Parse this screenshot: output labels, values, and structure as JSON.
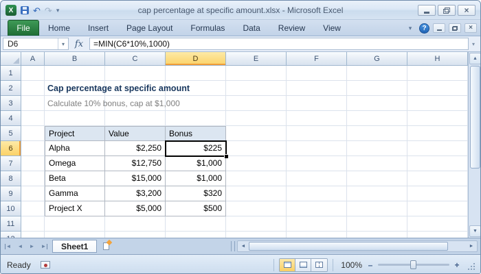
{
  "window": {
    "title": "cap percentage at specific amount.xlsx  -  Microsoft Excel"
  },
  "ribbon": {
    "file_tab": "File",
    "tabs": [
      "Home",
      "Insert",
      "Page Layout",
      "Formulas",
      "Data",
      "Review",
      "View"
    ]
  },
  "formula_bar": {
    "name_box": "D6",
    "fx_label": "fx",
    "formula": "=MIN(C6*10%,1000)"
  },
  "grid": {
    "columns": [
      "A",
      "B",
      "C",
      "D",
      "E",
      "F",
      "G",
      "H"
    ],
    "rows": [
      "1",
      "2",
      "3",
      "4",
      "5",
      "6",
      "7",
      "8",
      "9",
      "10",
      "11",
      "12"
    ],
    "selected_cell": "D6",
    "selected_column": "D",
    "selected_row": "6",
    "title": "Cap percentage at specific amount",
    "subtitle": "Calculate 10% bonus, cap at $1,000",
    "table": {
      "headers": [
        "Project",
        "Value",
        "Bonus"
      ],
      "rows": [
        [
          "Alpha",
          "$2,250",
          "$225"
        ],
        [
          "Omega",
          "$12,750",
          "$1,000"
        ],
        [
          "Beta",
          "$15,000",
          "$1,000"
        ],
        [
          "Gamma",
          "$3,200",
          "$320"
        ],
        [
          "Project X",
          "$5,000",
          "$500"
        ]
      ]
    }
  },
  "sheet_bar": {
    "tabs": [
      "Sheet1"
    ]
  },
  "status_bar": {
    "status": "Ready",
    "zoom": "100%"
  },
  "colors": {
    "file_tab_green": "#1e6c34",
    "selection_border": "#000000",
    "header_highlight": "#fbd268",
    "table_header_fill": "#dce6f1",
    "grid_line": "#dbe2ec"
  },
  "icons": {
    "excel_logo": "X",
    "undo": "↶",
    "redo": "↷",
    "caret_down": "▾",
    "close": "×",
    "help": "?",
    "scroll_up": "▲",
    "scroll_down": "▼",
    "scroll_left": "◄",
    "scroll_right": "►",
    "nav_first": "◄",
    "nav_prev": "◄",
    "nav_next": "►",
    "nav_last": "►",
    "zoom_out": "–",
    "zoom_in": "+"
  }
}
